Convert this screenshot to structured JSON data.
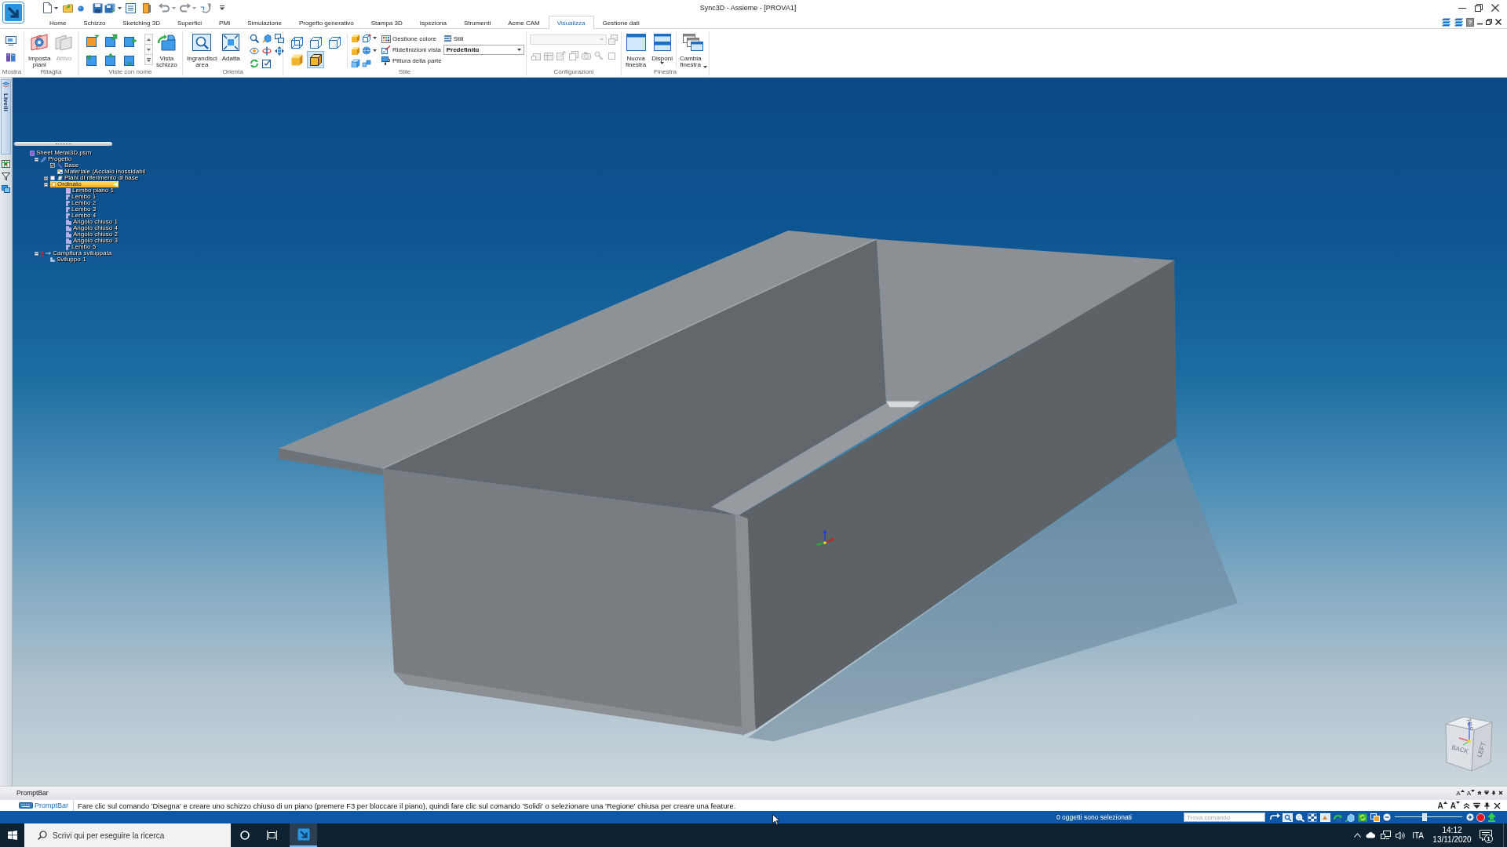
{
  "window": {
    "title": "Sync3D - Assieme - [PROVA1]",
    "help": "?"
  },
  "tabs": [
    {
      "label": "Home",
      "selected": false
    },
    {
      "label": "Schizzo",
      "selected": false
    },
    {
      "label": "Sketching 3D",
      "selected": false
    },
    {
      "label": "Superfici",
      "selected": false
    },
    {
      "label": "PMI",
      "selected": false
    },
    {
      "label": "Simulazione",
      "selected": false
    },
    {
      "label": "Progetto generativo",
      "selected": false
    },
    {
      "label": "Stampa 3D",
      "selected": false
    },
    {
      "label": "Ispeziona",
      "selected": false
    },
    {
      "label": "Strumenti",
      "selected": false
    },
    {
      "label": "Acme CAM",
      "selected": false
    },
    {
      "label": "Visualizza",
      "selected": true
    },
    {
      "label": "Gestione dati",
      "selected": false
    }
  ],
  "ribbon_groups": [
    {
      "kind": "mostra",
      "label": "Mostra"
    },
    {
      "kind": "ritaglia",
      "label": "Ritaglia",
      "buttons": [
        {
          "label": "Imposta piani",
          "disabled": false
        },
        {
          "label": "Attivo",
          "disabled": true
        }
      ]
    },
    {
      "kind": "viste",
      "label": "Viste con nome",
      "buttons": [
        {
          "label": "Vista schizzo"
        }
      ]
    },
    {
      "kind": "orienta",
      "label": "Orienta",
      "buttons": [
        {
          "label": "Ingrandisci area"
        },
        {
          "label": "Adatta"
        }
      ]
    },
    {
      "kind": "stile",
      "label": "Stile",
      "view_styles": [
        {
          "selected": false
        },
        {
          "selected": false
        },
        {
          "selected": false
        },
        {
          "selected": false
        },
        {
          "selected": true
        }
      ],
      "commands": [
        {
          "label": "Gestione colore"
        },
        {
          "label": "Ridefinizioni vista"
        },
        {
          "label": "Pittura della parte"
        }
      ],
      "styles_button": {
        "label": "Stili"
      },
      "style_select": {
        "value": "Predefinito"
      }
    },
    {
      "kind": "configurazioni",
      "label": "Configurazioni",
      "disabled": true
    },
    {
      "kind": "finestra",
      "label": "Finestra",
      "buttons": [
        {
          "label": "Nuova finestra"
        },
        {
          "label": "Disponi"
        },
        {
          "label": "Cambia finestra"
        }
      ]
    }
  ],
  "side_tabs": [
    {
      "label": "Livelli"
    }
  ],
  "tree": {
    "items": [
      {
        "label": "Sheet Metal3D.psm",
        "kind": "file",
        "selected": false,
        "children": [
          {
            "label": "Progetto",
            "kind": "design",
            "selected": false,
            "expanded": true,
            "children": [
              {
                "label": "Base",
                "kind": "sketch",
                "selected": false,
                "checked": true
              },
              {
                "label": "Materiale (Acciaio inossidabil",
                "kind": "material",
                "selected": false
              },
              {
                "label": "Piani di riferimento di base",
                "kind": "planes",
                "selected": false,
                "expanded": false,
                "checked": false
              },
              {
                "label": "Ordinato",
                "kind": "ordered",
                "selected": true,
                "expanded": true,
                "children": [
                  {
                    "label": "Lembo piano 1",
                    "kind": "flat_tab",
                    "selected": false
                  },
                  {
                    "label": "Lembo 1",
                    "kind": "flange",
                    "selected": false
                  },
                  {
                    "label": "Lembo 2",
                    "kind": "flange",
                    "selected": false
                  },
                  {
                    "label": "Lembo 3",
                    "kind": "flange",
                    "selected": false
                  },
                  {
                    "label": "Lembo 4",
                    "kind": "flange",
                    "selected": false
                  },
                  {
                    "label": "Angolo chiuso 1",
                    "kind": "corner",
                    "selected": false
                  },
                  {
                    "label": "Angolo chiuso 4",
                    "kind": "corner",
                    "selected": false
                  },
                  {
                    "label": "Angolo chiuso 2",
                    "kind": "corner",
                    "selected": false
                  },
                  {
                    "label": "Angolo chiuso 3",
                    "kind": "corner",
                    "selected": false
                  },
                  {
                    "label": "Lembo 5",
                    "kind": "flange",
                    "selected": false
                  }
                ]
              }
            ]
          },
          {
            "label": "Campitura sviluppata",
            "kind": "flat_group",
            "selected": false,
            "expanded": true,
            "warning": true,
            "children": [
              {
                "label": "Sviluppo 1",
                "kind": "flat_pattern",
                "selected": false
              }
            ]
          }
        ]
      }
    ]
  },
  "view_cube": {
    "faces": [
      "TOP",
      "BACK",
      "LEFT"
    ]
  },
  "promptbar": {
    "title": "PromptBar",
    "header_font_buttons": [
      "A",
      "A"
    ],
    "label": "PromptBar",
    "message": "Fare clic sul comando 'Disegna' e creare uno schizzo chiuso di un piano (premere F3 per bloccare il piano), quindi fare clic sul comando 'Solidi' o selezionare una 'Regione' chiusa per creare una feature.",
    "line_font_buttons": [
      "A",
      "A"
    ]
  },
  "status_bar": {
    "selection": "0 oggetti sono selezionati",
    "command_search": {
      "placeholder": "Trova comando"
    },
    "zoom_slider": {
      "level": 0.44
    }
  },
  "taskbar": {
    "search": {
      "placeholder": "Scrivi qui per eseguire la ricerca"
    },
    "apps": [
      {
        "active": true
      }
    ],
    "language": "ITA",
    "time": "14:12",
    "date": "13/11/2020",
    "notifications": "1"
  }
}
